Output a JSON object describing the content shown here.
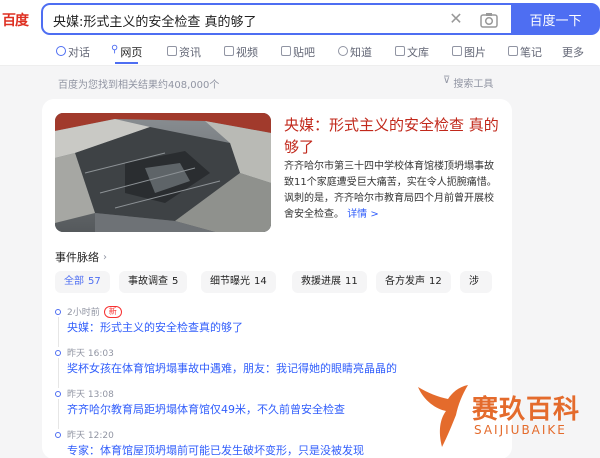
{
  "logo": "百度",
  "search": {
    "query": "央媒:形式主义的安全检查 真的够了",
    "button_label": "百度一下"
  },
  "tabs": [
    {
      "label": "对话"
    },
    {
      "label": "网页"
    },
    {
      "label": "资讯"
    },
    {
      "label": "视频"
    },
    {
      "label": "贴吧"
    },
    {
      "label": "知道"
    },
    {
      "label": "文库"
    },
    {
      "label": "图片"
    },
    {
      "label": "笔记"
    },
    {
      "label": "更多"
    }
  ],
  "result_count": "百度为您找到相关结果约408,000个",
  "tools_label": "搜索工具",
  "card": {
    "headline": "央媒：形式主义的安全检查 真的够了",
    "summary": "齐齐哈尔市第三十四中学校体育馆楼顶坍塌事故致11个家庭遭受巨大痛苦，实在令人扼腕痛惜。讽刺的是，齐齐哈尔市教育局四个月前曾开展校舍安全检查。",
    "detail_link": "详情 >"
  },
  "timeline": {
    "title": "事件脉络",
    "chips": [
      {
        "label": "全部",
        "count": "57"
      },
      {
        "label": "事故调查",
        "count": "5"
      },
      {
        "label": "细节曝光",
        "count": "14"
      },
      {
        "label": "救援进展",
        "count": "11"
      },
      {
        "label": "各方发声",
        "count": "12"
      },
      {
        "label": "涉",
        "count": ""
      }
    ],
    "events": [
      {
        "time": "2小时前",
        "badge": "新",
        "title": "央媒：形式主义的安全检查真的够了"
      },
      {
        "time": "昨天 16:03",
        "badge": "",
        "title": "奖杯女孩在体育馆坍塌事故中遇难，朋友：我记得她的眼睛亮晶晶的"
      },
      {
        "time": "昨天 13:08",
        "badge": "",
        "title": "齐齐哈尔教育局距坍塌体育馆仅49米，不久前曾安全检查"
      },
      {
        "time": "昨天 12:20",
        "badge": "",
        "title": "专家：体育馆屋顶坍塌前可能已发生破坏变形，只是没被发现"
      }
    ]
  },
  "watermark": {
    "text": "赛玖百科",
    "sub": "SAIJIUBAIKE"
  },
  "colors": {
    "brand_blue": "#4e6ef2",
    "headline_red": "#c1281b",
    "link_blue": "#315efb",
    "watermark_orange": "#e46b2c"
  }
}
